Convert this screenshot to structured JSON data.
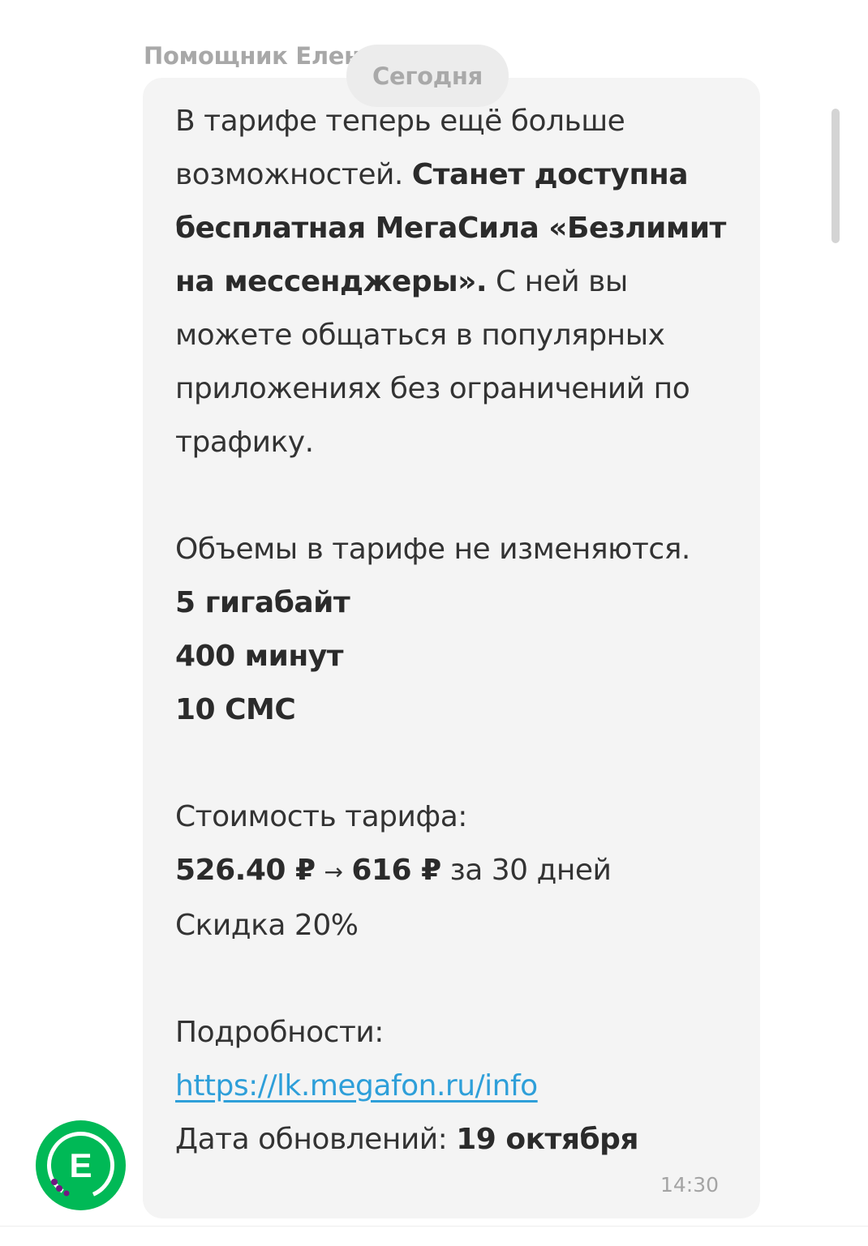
{
  "sender": {
    "name": "Помощник Елен"
  },
  "date_separator": "Сегодня",
  "message": {
    "p1_regular": "В тарифе теперь ещё больше возможностей. ",
    "p1_bold": "Станет доступна бесплатная МегаСила «Безлимит на мессенджеры».",
    "p1_tail": " С ней вы можете общаться в популярных приложениях без ограничений по трафику.",
    "volumes_heading": "Объемы в тарифе не изменяются.",
    "volumes": [
      "5 гигабайт",
      "400 минут",
      "10 СМС"
    ],
    "price_heading": "Стоимость тарифа:",
    "price_old": "526.40 ₽",
    "price_arrow": "→",
    "price_new": "616 ₽",
    "price_period": "за 30 дней",
    "discount": "Скидка 20%",
    "details_label": "Подробности:",
    "details_link": "https://lk.megafon.ru/info",
    "update_label": "Дата обновлений: ",
    "update_date": "19 октября",
    "time": "14:30"
  },
  "avatar": {
    "letter": "E",
    "color": "#00b956"
  },
  "colors": {
    "bubble": "#f4f4f4",
    "link": "#2e9fd9",
    "brand": "#00b956"
  }
}
